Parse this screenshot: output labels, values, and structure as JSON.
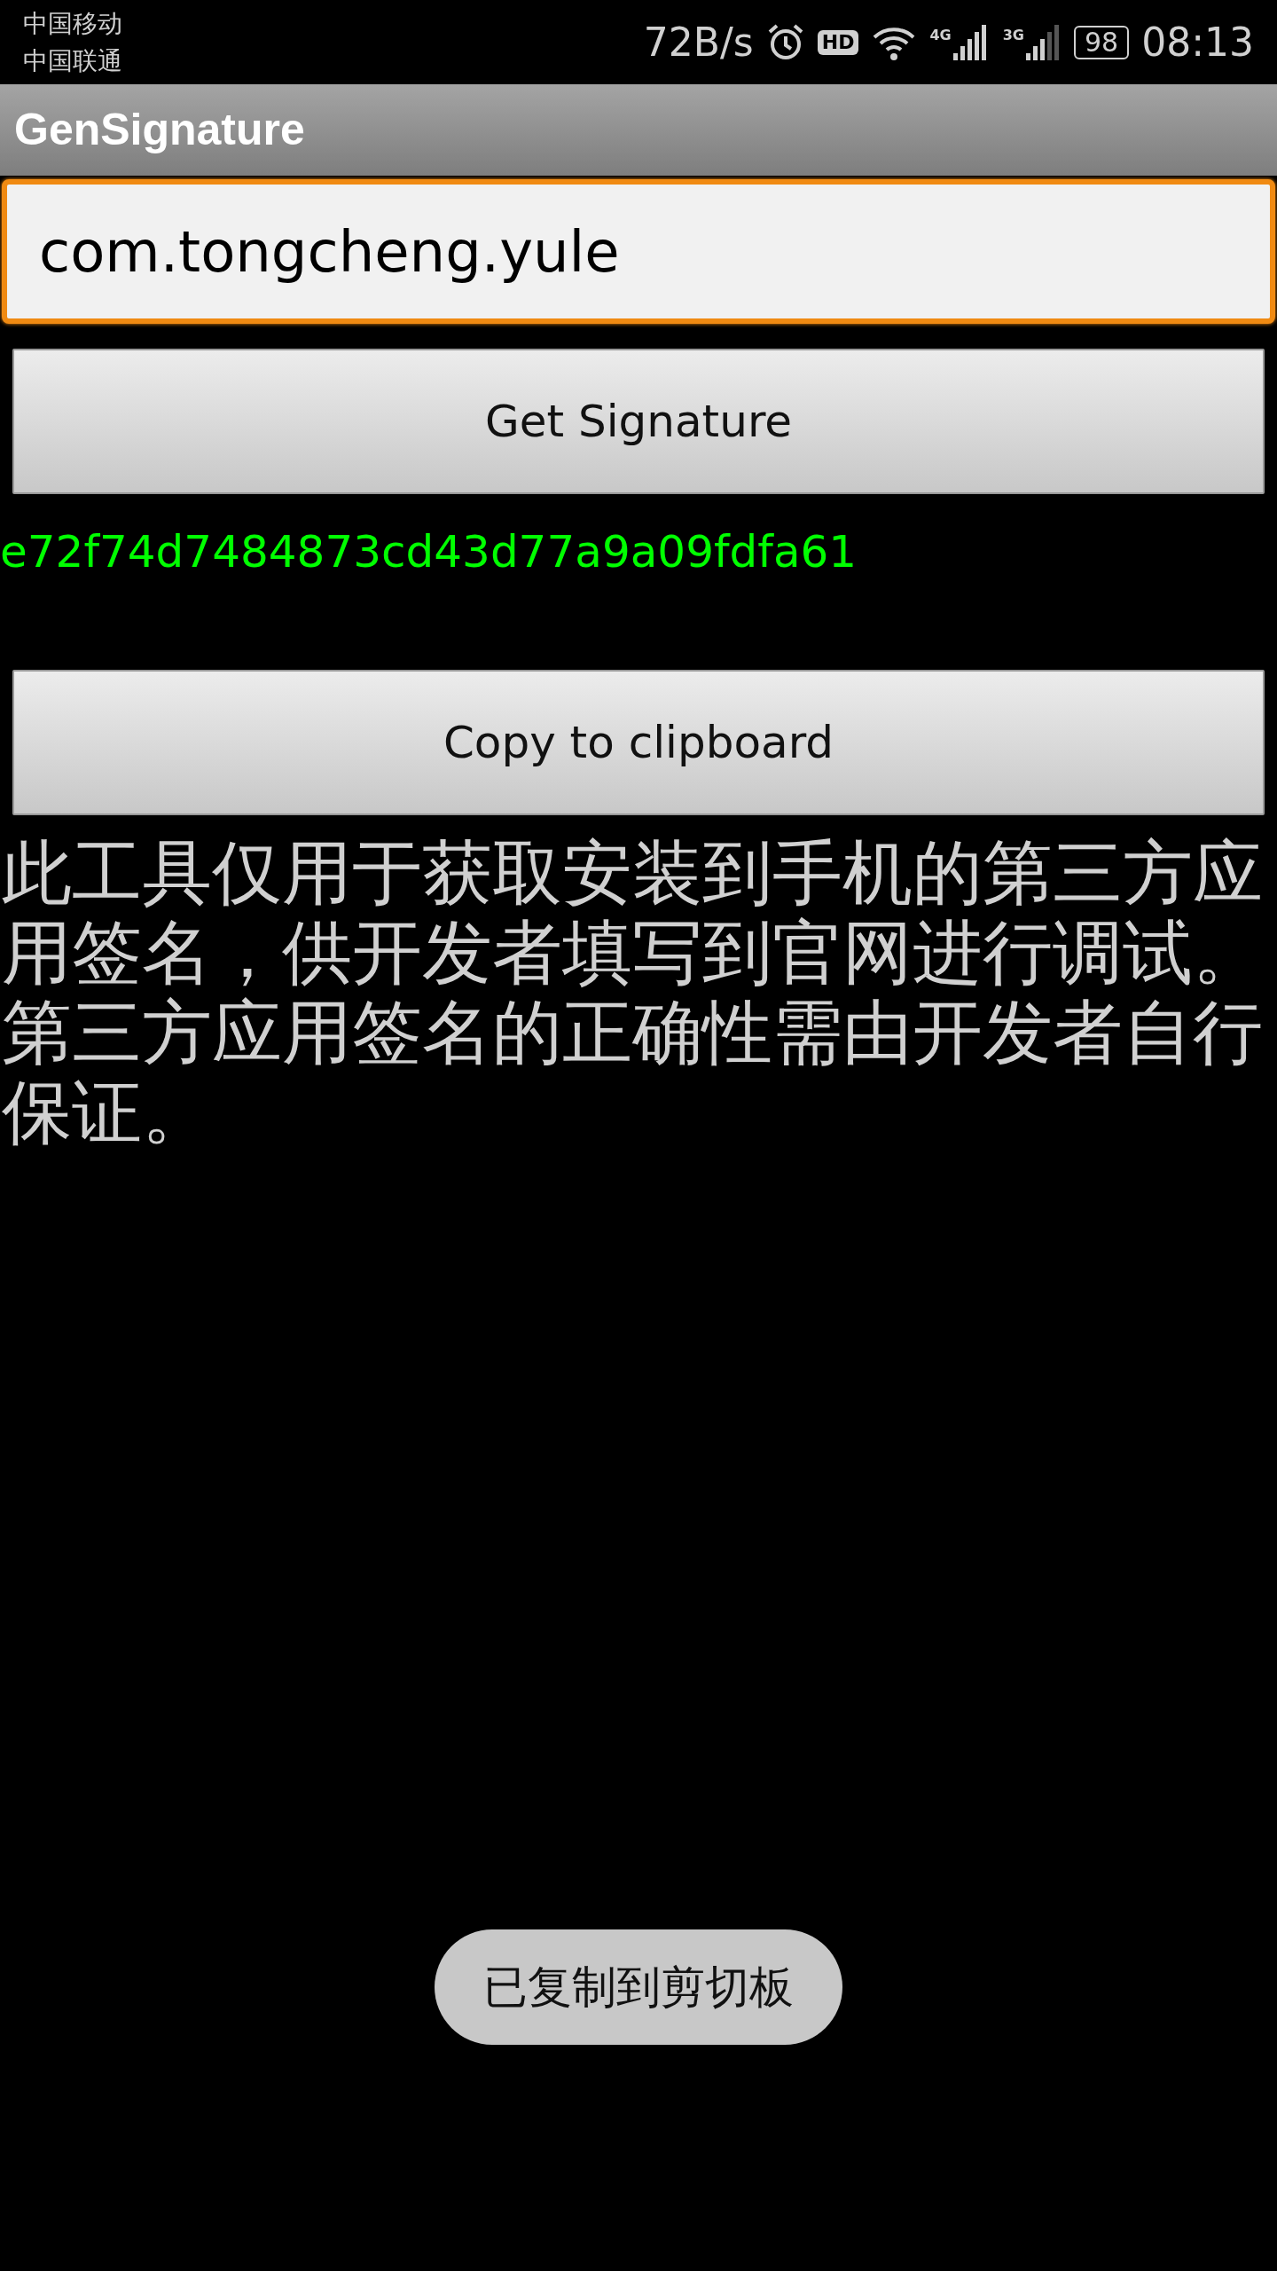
{
  "status_bar": {
    "carriers": [
      "中国移动",
      "中国联通"
    ],
    "net_speed": "72B/s",
    "hd_badge": "HD",
    "signals": [
      {
        "network": "4G"
      },
      {
        "network": "3G"
      }
    ],
    "battery": "98",
    "time": "08:13"
  },
  "app_bar": {
    "title": "GenSignature"
  },
  "package_field": {
    "value": "com.tongcheng.yule",
    "focused": true
  },
  "get_button": {
    "label": "Get Signature"
  },
  "signature": "e72f74d7484873cd43d77a9a09fdfa61",
  "copy_button": {
    "label": "Copy to clipboard"
  },
  "notice": "此工具仅用于获取安装到手机的第三方应用签名，供开发者填写到官网进行调试。第三方应用签名的正确性需由开发者自行保证。",
  "toast": "已复制到剪切板"
}
